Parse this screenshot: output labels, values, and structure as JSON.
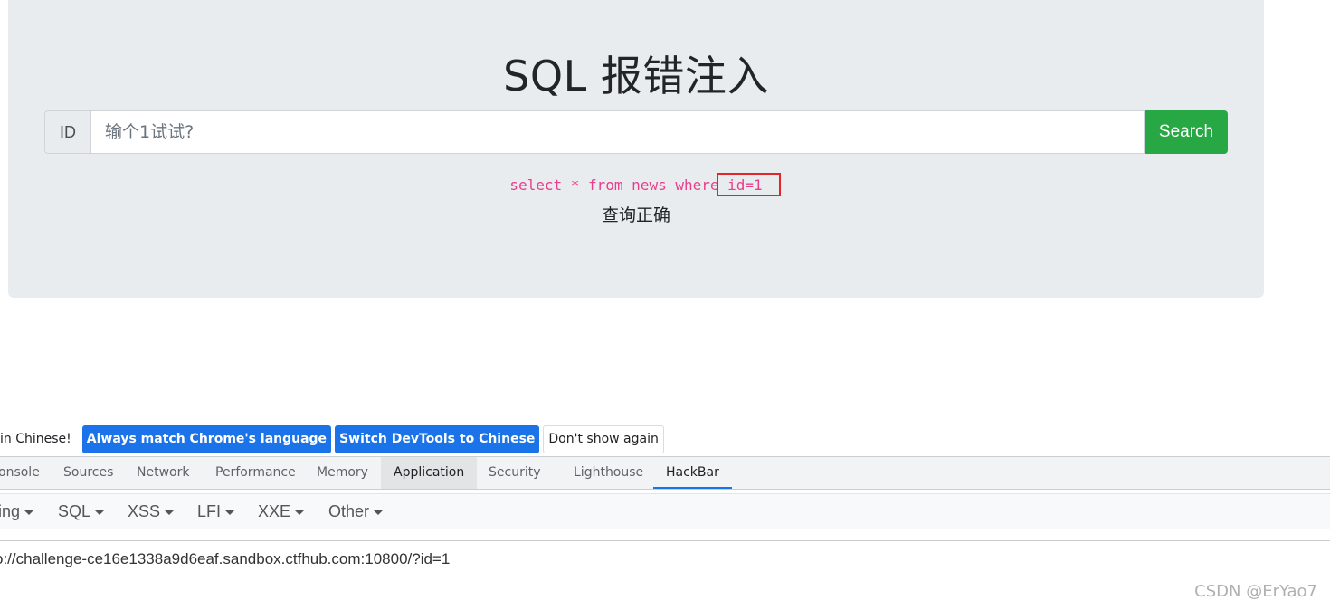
{
  "page": {
    "title": "SQL 报错注入",
    "input_addon": "ID",
    "search_placeholder": "输个1试试?",
    "search_button": "Search",
    "sql_query": "select * from news where id=1",
    "result": "查询正确"
  },
  "devtools": {
    "infobar": {
      "message": "in Chinese!",
      "buttons": [
        "Always match Chrome's language",
        "Switch DevTools to Chinese",
        "Don't show again"
      ]
    },
    "tabs": [
      "onsole",
      "Sources",
      "Network",
      "Performance",
      "Memory",
      "Application",
      "Security",
      "Lighthouse",
      "HackBar"
    ],
    "active_tab": "HackBar",
    "hackbar": {
      "menus": [
        "ing",
        "SQL",
        "XSS",
        "LFI",
        "XXE",
        "Other"
      ],
      "url": "o://challenge-ce16e1338a9d6eaf.sandbox.ctfhub.com:10800/?id=1"
    }
  },
  "watermark": "CSDN @ErYao7",
  "colors": {
    "search_button": "#28a745",
    "sql_text": "#e83e8c",
    "highlight_box": "#e0262b",
    "devtools_primary": "#1a73e8"
  }
}
